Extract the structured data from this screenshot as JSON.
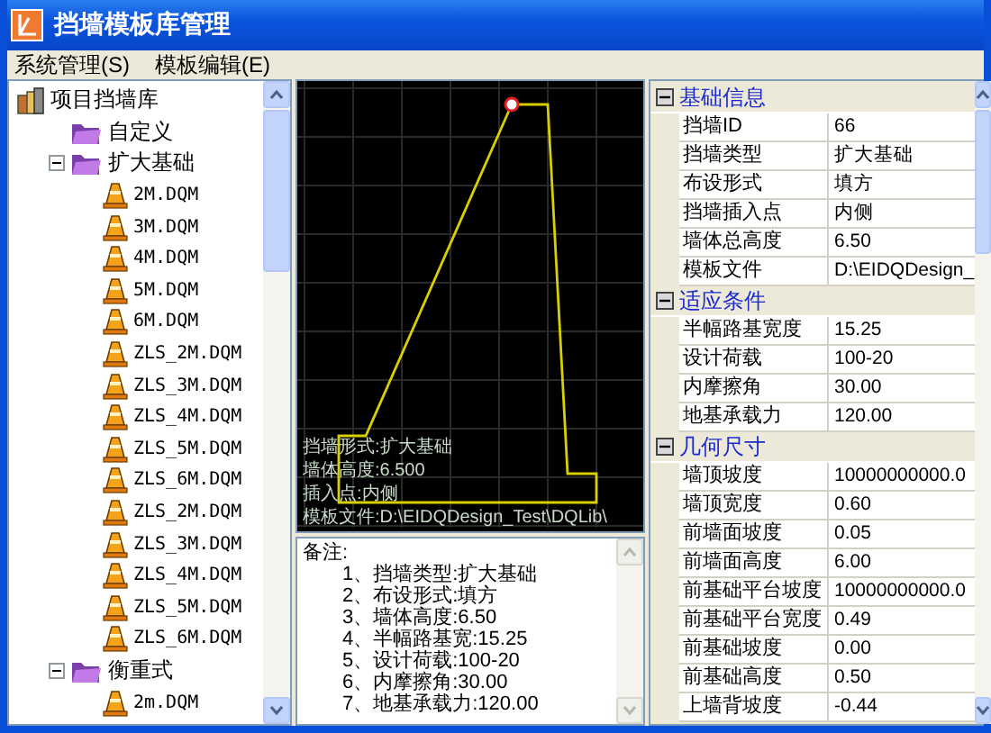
{
  "window": {
    "title": "挡墙模板库管理"
  },
  "menu": [
    {
      "label": "系统管理(S)"
    },
    {
      "label": "模板编辑(E)"
    }
  ],
  "tree": [
    {
      "label": "项目挡墙库",
      "kind": "library",
      "children": [
        {
          "label": "自定义",
          "kind": "folder"
        },
        {
          "label": "扩大基础",
          "kind": "folder",
          "expanded": true,
          "children": [
            {
              "label": "2M.DQM",
              "kind": "file"
            },
            {
              "label": "3M.DQM",
              "kind": "file"
            },
            {
              "label": "4M.DQM",
              "kind": "file"
            },
            {
              "label": "5M.DQM",
              "kind": "file"
            },
            {
              "label": "6M.DQM",
              "kind": "file"
            },
            {
              "label": "ZLS_2M.DQM",
              "kind": "file"
            },
            {
              "label": "ZLS_3M.DQM",
              "kind": "file"
            },
            {
              "label": "ZLS_4M.DQM",
              "kind": "file"
            },
            {
              "label": "ZLS_5M.DQM",
              "kind": "file"
            },
            {
              "label": "ZLS_6M.DQM",
              "kind": "file"
            },
            {
              "label": "ZLS_2M.DQM",
              "kind": "file"
            },
            {
              "label": "ZLS_3M.DQM",
              "kind": "file"
            },
            {
              "label": "ZLS_4M.DQM",
              "kind": "file"
            },
            {
              "label": "ZLS_5M.DQM",
              "kind": "file"
            },
            {
              "label": "ZLS_6M.DQM",
              "kind": "file"
            }
          ]
        },
        {
          "label": "衡重式",
          "kind": "folder",
          "expanded": true,
          "children": [
            {
              "label": "2m.DQM",
              "kind": "file"
            }
          ]
        }
      ]
    }
  ],
  "canvas": {
    "overlay": [
      "挡墙形式:扩大基础",
      "墙体高度:6.500",
      "插入点:内侧",
      "模板文件:D:\\EIDQDesign_Test\\DQLib\\"
    ]
  },
  "notes": {
    "label": "备注:",
    "lines": [
      "1、挡墙类型:扩大基础",
      "2、布设形式:填方",
      "3、墙体高度:6.50",
      "4、半幅路基宽:15.25",
      "5、设计荷载:100-20",
      "6、内摩擦角:30.00",
      "7、地基承载力:120.00"
    ]
  },
  "properties": [
    {
      "title": "基础信息",
      "expanded": true,
      "rows": [
        {
          "name": "挡墙ID",
          "value": "66"
        },
        {
          "name": "挡墙类型",
          "value": "扩大基础"
        },
        {
          "name": "布设形式",
          "value": "填方"
        },
        {
          "name": "挡墙插入点",
          "value": "内侧"
        },
        {
          "name": "墙体总高度",
          "value": "6.50"
        },
        {
          "name": "模板文件",
          "value": "D:\\EIDQDesign_"
        }
      ]
    },
    {
      "title": "适应条件",
      "expanded": true,
      "rows": [
        {
          "name": "半幅路基宽度",
          "value": "15.25"
        },
        {
          "name": "设计荷载",
          "value": "100-20"
        },
        {
          "name": "内摩擦角",
          "value": "30.00"
        },
        {
          "name": "地基承载力",
          "value": "120.00"
        }
      ]
    },
    {
      "title": "几何尺寸",
      "expanded": true,
      "rows": [
        {
          "name": "墙顶坡度",
          "value": "10000000000.0"
        },
        {
          "name": "墙顶宽度",
          "value": "0.60"
        },
        {
          "name": "前墙面坡度",
          "value": "0.05"
        },
        {
          "name": "前墙面高度",
          "value": "6.00"
        },
        {
          "name": "前基础平台坡度",
          "value": "10000000000.0"
        },
        {
          "name": "前基础平台宽度",
          "value": "0.49"
        },
        {
          "name": "前基础坡度",
          "value": "0.00"
        },
        {
          "name": "前基础高度",
          "value": "0.50"
        },
        {
          "name": "上墙背坡度",
          "value": "-0.44"
        }
      ]
    }
  ]
}
